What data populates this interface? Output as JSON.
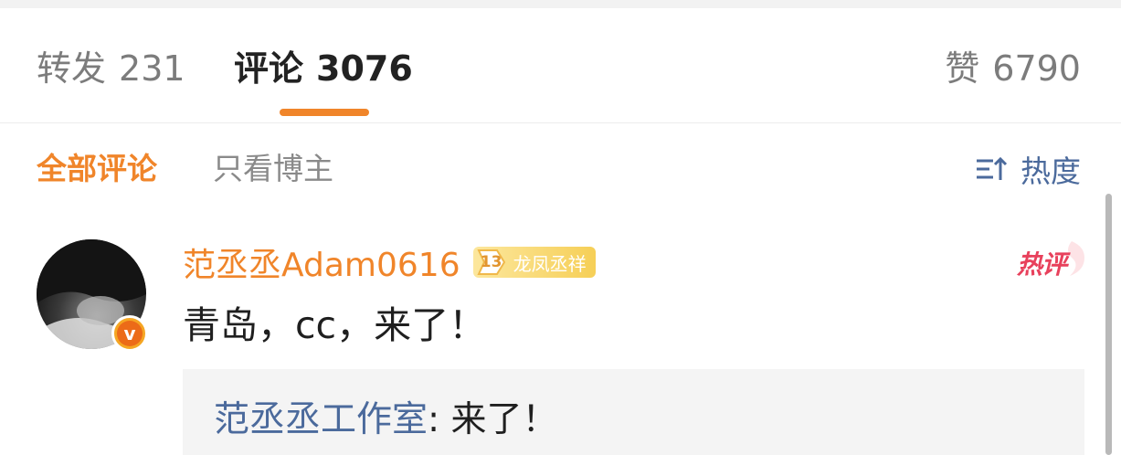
{
  "tabs": {
    "repost": {
      "label": "转发",
      "count": "231"
    },
    "comments": {
      "label": "评论",
      "count": "3076"
    },
    "likes": {
      "label": "赞",
      "count": "6790"
    }
  },
  "filters": {
    "all": "全部评论",
    "blogger_only": "只看博主"
  },
  "sort": {
    "label": "热度",
    "icon": "sort-icon"
  },
  "comment": {
    "username": "范丞丞Adam0616",
    "fan_badge": {
      "level": "13",
      "title": "龙凤丞祥"
    },
    "hot_label": "热评",
    "text": "青岛，cc，来了！",
    "verified_icon": "v",
    "reply": {
      "author": "范丞丞工作室",
      "separator": ":",
      "text": " 来了！"
    }
  },
  "colors": {
    "accent": "#f0852a",
    "link": "#4b6a9c",
    "hot": "#e8415c"
  }
}
